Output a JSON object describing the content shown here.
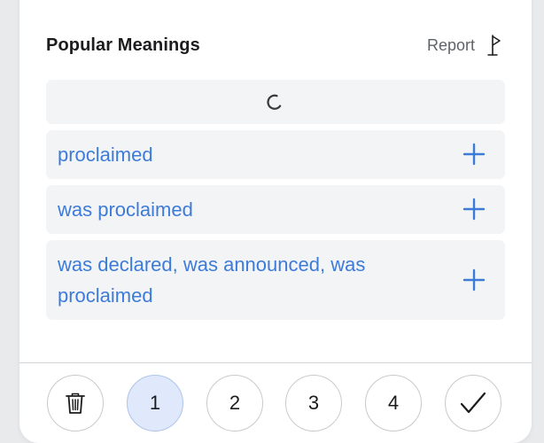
{
  "panel": {
    "title": "Popular Meanings",
    "report_label": "Report"
  },
  "meanings": [
    {
      "text": "proclaimed"
    },
    {
      "text": "was proclaimed"
    },
    {
      "text": "was declared, was announced, was proclaimed"
    }
  ],
  "footer": {
    "buttons": [
      "1",
      "2",
      "3",
      "4"
    ],
    "active_button": "1"
  },
  "colors": {
    "accent": "#3d7bd9",
    "row_background": "#f3f4f6",
    "active_button_bg": "#dfe9fb"
  },
  "icons": {
    "report": "flag-icon",
    "loading": "spinner-icon",
    "add": "plus-icon",
    "delete": "trash-icon",
    "confirm": "checkmark-icon"
  }
}
